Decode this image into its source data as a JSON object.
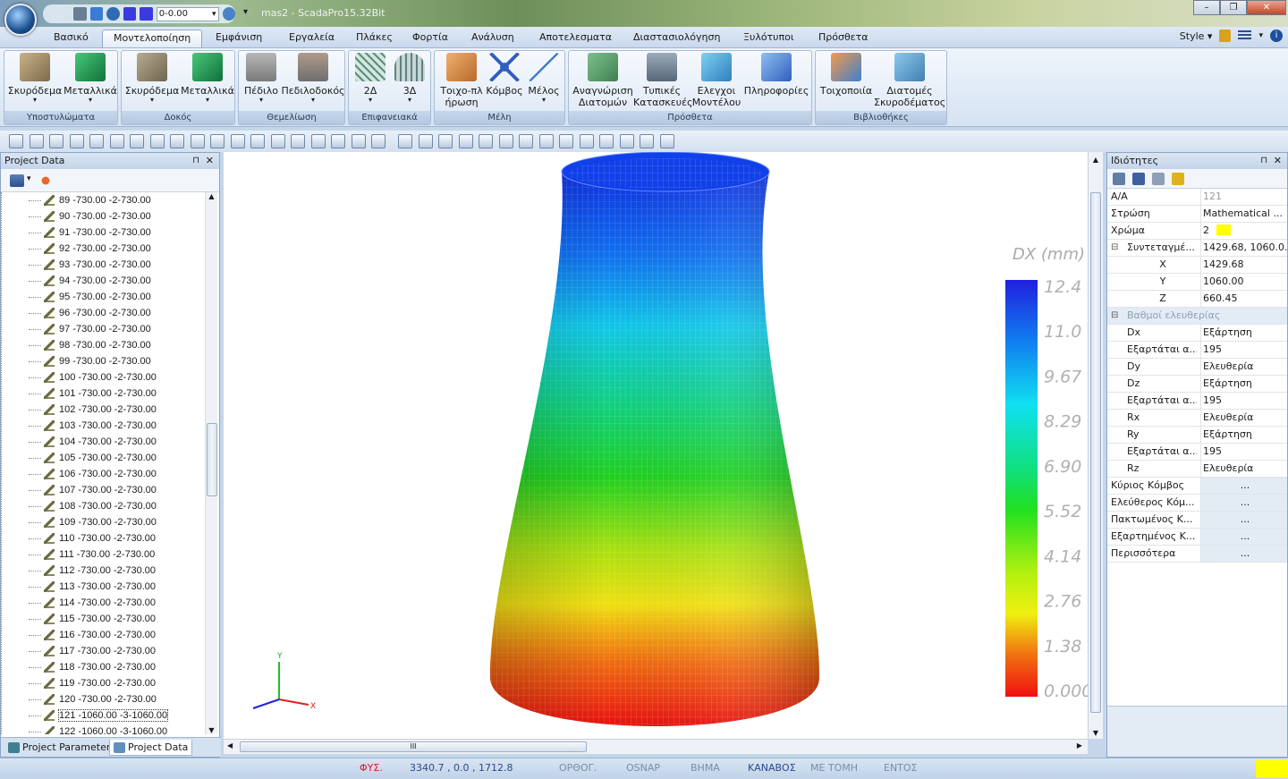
{
  "window": {
    "title": "mas2 - ScadaPro15.32Bit",
    "controls": [
      "–",
      "❐",
      "✕"
    ]
  },
  "quick_access": {
    "combo_value": "0-0.00"
  },
  "menu": {
    "tabs": [
      {
        "label": "Βασικό",
        "active": false
      },
      {
        "label": "Μοντελοποίηση",
        "active": true
      },
      {
        "label": "Εμφάνιση",
        "active": false
      },
      {
        "label": "Εργαλεία",
        "active": false
      },
      {
        "label": "Πλάκες",
        "active": false
      },
      {
        "label": "Φορτία",
        "active": false
      },
      {
        "label": "Ανάλυση",
        "active": false
      },
      {
        "label": "Αποτελεσματα",
        "active": false
      },
      {
        "label": "Διαστασιολόγηση",
        "active": false
      },
      {
        "label": "Ξυλότυποι",
        "active": false
      },
      {
        "label": "Πρόσθετα",
        "active": false
      }
    ],
    "style_label": "Style"
  },
  "ribbon": {
    "groups": [
      {
        "label": "Υποστυλώματα",
        "buttons": [
          {
            "label": "Σκυρόδεμα",
            "color": "#9a8460"
          },
          {
            "label": "Μεταλλικά",
            "color": "#1f9a4c"
          }
        ]
      },
      {
        "label": "Δοκός",
        "buttons": [
          {
            "label": "Σκυρόδεμα",
            "color": "#8a7a60"
          },
          {
            "label": "Μεταλλικά",
            "color": "#1f9a4c"
          }
        ]
      },
      {
        "label": "Θεμελίωση",
        "buttons": [
          {
            "label": "Πέδιλο",
            "color": "#8c8c8c"
          },
          {
            "label": "Πεδιλοδοκός",
            "color": "#7d7d7d"
          }
        ]
      },
      {
        "label": "Επιφανειακά",
        "buttons": [
          {
            "label": "2Δ",
            "color": "#6f9f8d"
          },
          {
            "label": "3Δ",
            "color": "#7f9fa0"
          }
        ]
      },
      {
        "label": "Μέλη",
        "buttons": [
          {
            "label": "Τοιχο-πλήρωση",
            "color": "#c97a37"
          },
          {
            "label": "Κόμβος",
            "color": "#2f5fbf"
          },
          {
            "label": "Μέλος",
            "color": "#3f7fcf"
          }
        ]
      },
      {
        "label": "Πρόσθετα",
        "buttons": [
          {
            "label": "Αναγνώριση Διατομών",
            "color": "#4f8f5f"
          },
          {
            "label": "Τυπικές Κατασκευές",
            "color": "#6a7f8f"
          },
          {
            "label": "Ελεγχοι Μοντέλου",
            "color": "#3f8fbf"
          },
          {
            "label": "Πληροφορίες",
            "color": "#3f6fbf"
          }
        ]
      },
      {
        "label": "Βιβλιοθήκες",
        "buttons": [
          {
            "label": "Τοιχοποιία",
            "color": "#d56a2a"
          },
          {
            "label": "Διατομές Σκυροδέματος",
            "color": "#4f8fbf"
          }
        ]
      }
    ]
  },
  "left_panel": {
    "title": "Project Data",
    "pin": "⊓",
    "close": "✕",
    "rows": [
      "89 -730.00 -2-730.00",
      "90 -730.00 -2-730.00",
      "91 -730.00 -2-730.00",
      "92 -730.00 -2-730.00",
      "93 -730.00 -2-730.00",
      "94 -730.00 -2-730.00",
      "95 -730.00 -2-730.00",
      "96 -730.00 -2-730.00",
      "97 -730.00 -2-730.00",
      "98 -730.00 -2-730.00",
      "99 -730.00 -2-730.00",
      "100 -730.00 -2-730.00",
      "101 -730.00 -2-730.00",
      "102 -730.00 -2-730.00",
      "103 -730.00 -2-730.00",
      "104 -730.00 -2-730.00",
      "105 -730.00 -2-730.00",
      "106 -730.00 -2-730.00",
      "107 -730.00 -2-730.00",
      "108 -730.00 -2-730.00",
      "109 -730.00 -2-730.00",
      "110 -730.00 -2-730.00",
      "111 -730.00 -2-730.00",
      "112 -730.00 -2-730.00",
      "113 -730.00 -2-730.00",
      "114 -730.00 -2-730.00",
      "115 -730.00 -2-730.00",
      "116 -730.00 -2-730.00",
      "117 -730.00 -2-730.00",
      "118 -730.00 -2-730.00",
      "119 -730.00 -2-730.00",
      "120 -730.00 -2-730.00",
      "121 -1060.00 -3-1060.00",
      "122 -1060.00 -3-1060.00"
    ],
    "selected_index": 32,
    "tabs": [
      {
        "label": "Project Parameter",
        "active": false
      },
      {
        "label": "Project Data",
        "active": true
      }
    ]
  },
  "viewport": {
    "legend_title": "DX (mm)",
    "legend_values": [
      "12.4",
      "11.0",
      "9.67",
      "8.29",
      "6.90",
      "5.52",
      "4.14",
      "2.76",
      "1.38",
      "0.000"
    ],
    "axis": {
      "y": "Y",
      "x": "X"
    },
    "scroll_grip": "III"
  },
  "properties": {
    "title": "Ιδιότητες",
    "pin": "⊓",
    "close": "✕",
    "rows": [
      {
        "key": "Α/Α",
        "value": "121",
        "type": "grey"
      },
      {
        "key": "Στρώση",
        "value": "Mathematical ...",
        "type": "normal"
      },
      {
        "key": "Χρώμα",
        "value": "2",
        "type": "color",
        "color": "#ffff00"
      },
      {
        "key": "Συντεταγμέ...",
        "value": "1429.68, 1060.0...",
        "type": "expand",
        "expander": "⊟"
      },
      {
        "key": "X",
        "value": "1429.68",
        "type": "sub-center"
      },
      {
        "key": "Y",
        "value": "1060.00",
        "type": "sub-center"
      },
      {
        "key": "Z",
        "value": "660.45",
        "type": "sub-center"
      },
      {
        "key": "Βαθμοί ελευθερίας",
        "value": "",
        "type": "cat",
        "expander": "⊟"
      },
      {
        "key": "Dx",
        "value": "Εξάρτηση",
        "type": "sub"
      },
      {
        "key": "Εξαρτάται α...",
        "value": "195",
        "type": "sub"
      },
      {
        "key": "Dy",
        "value": "Ελευθερία",
        "type": "sub"
      },
      {
        "key": "Dz",
        "value": "Εξάρτηση",
        "type": "sub"
      },
      {
        "key": "Εξαρτάται α...",
        "value": "195",
        "type": "sub"
      },
      {
        "key": "Rx",
        "value": "Ελευθερία",
        "type": "sub"
      },
      {
        "key": "Ry",
        "value": "Εξάρτηση",
        "type": "sub"
      },
      {
        "key": "Εξαρτάται α...",
        "value": "195",
        "type": "sub"
      },
      {
        "key": "Rz",
        "value": "Ελευθερία",
        "type": "sub"
      },
      {
        "key": "Κύριος Κόμβος",
        "value": "...",
        "type": "btn"
      },
      {
        "key": "Ελεύθερος Κόμ...",
        "value": "...",
        "type": "btn"
      },
      {
        "key": "Πακτωμένος Κ...",
        "value": "...",
        "type": "btn"
      },
      {
        "key": "Εξαρτημένος Κ...",
        "value": "...",
        "type": "btn"
      },
      {
        "key": "Περισσότερα",
        "value": "...",
        "type": "btn"
      }
    ]
  },
  "status": {
    "items": [
      {
        "label": "ΦΥΣ.",
        "color": "#cc2222"
      },
      {
        "label": "3340.7 , 0.0 , 1712.8",
        "color": "#2a4a8a"
      },
      {
        "label": "ΟΡΘΟΓ.",
        "color": "#7b8da2"
      },
      {
        "label": "OSNAP",
        "color": "#7b8da2"
      },
      {
        "label": "ΒΗΜΑ",
        "color": "#7b8da2"
      },
      {
        "label": "ΚΑΝΑΒΟΣ",
        "color": "#2a4a8a"
      },
      {
        "label": "ΜΕ ΤΟΜΗ",
        "color": "#7b8da2"
      },
      {
        "label": "ΕΝΤΟΣ",
        "color": "#7b8da2"
      }
    ],
    "indicator_color": "#ffff00"
  }
}
